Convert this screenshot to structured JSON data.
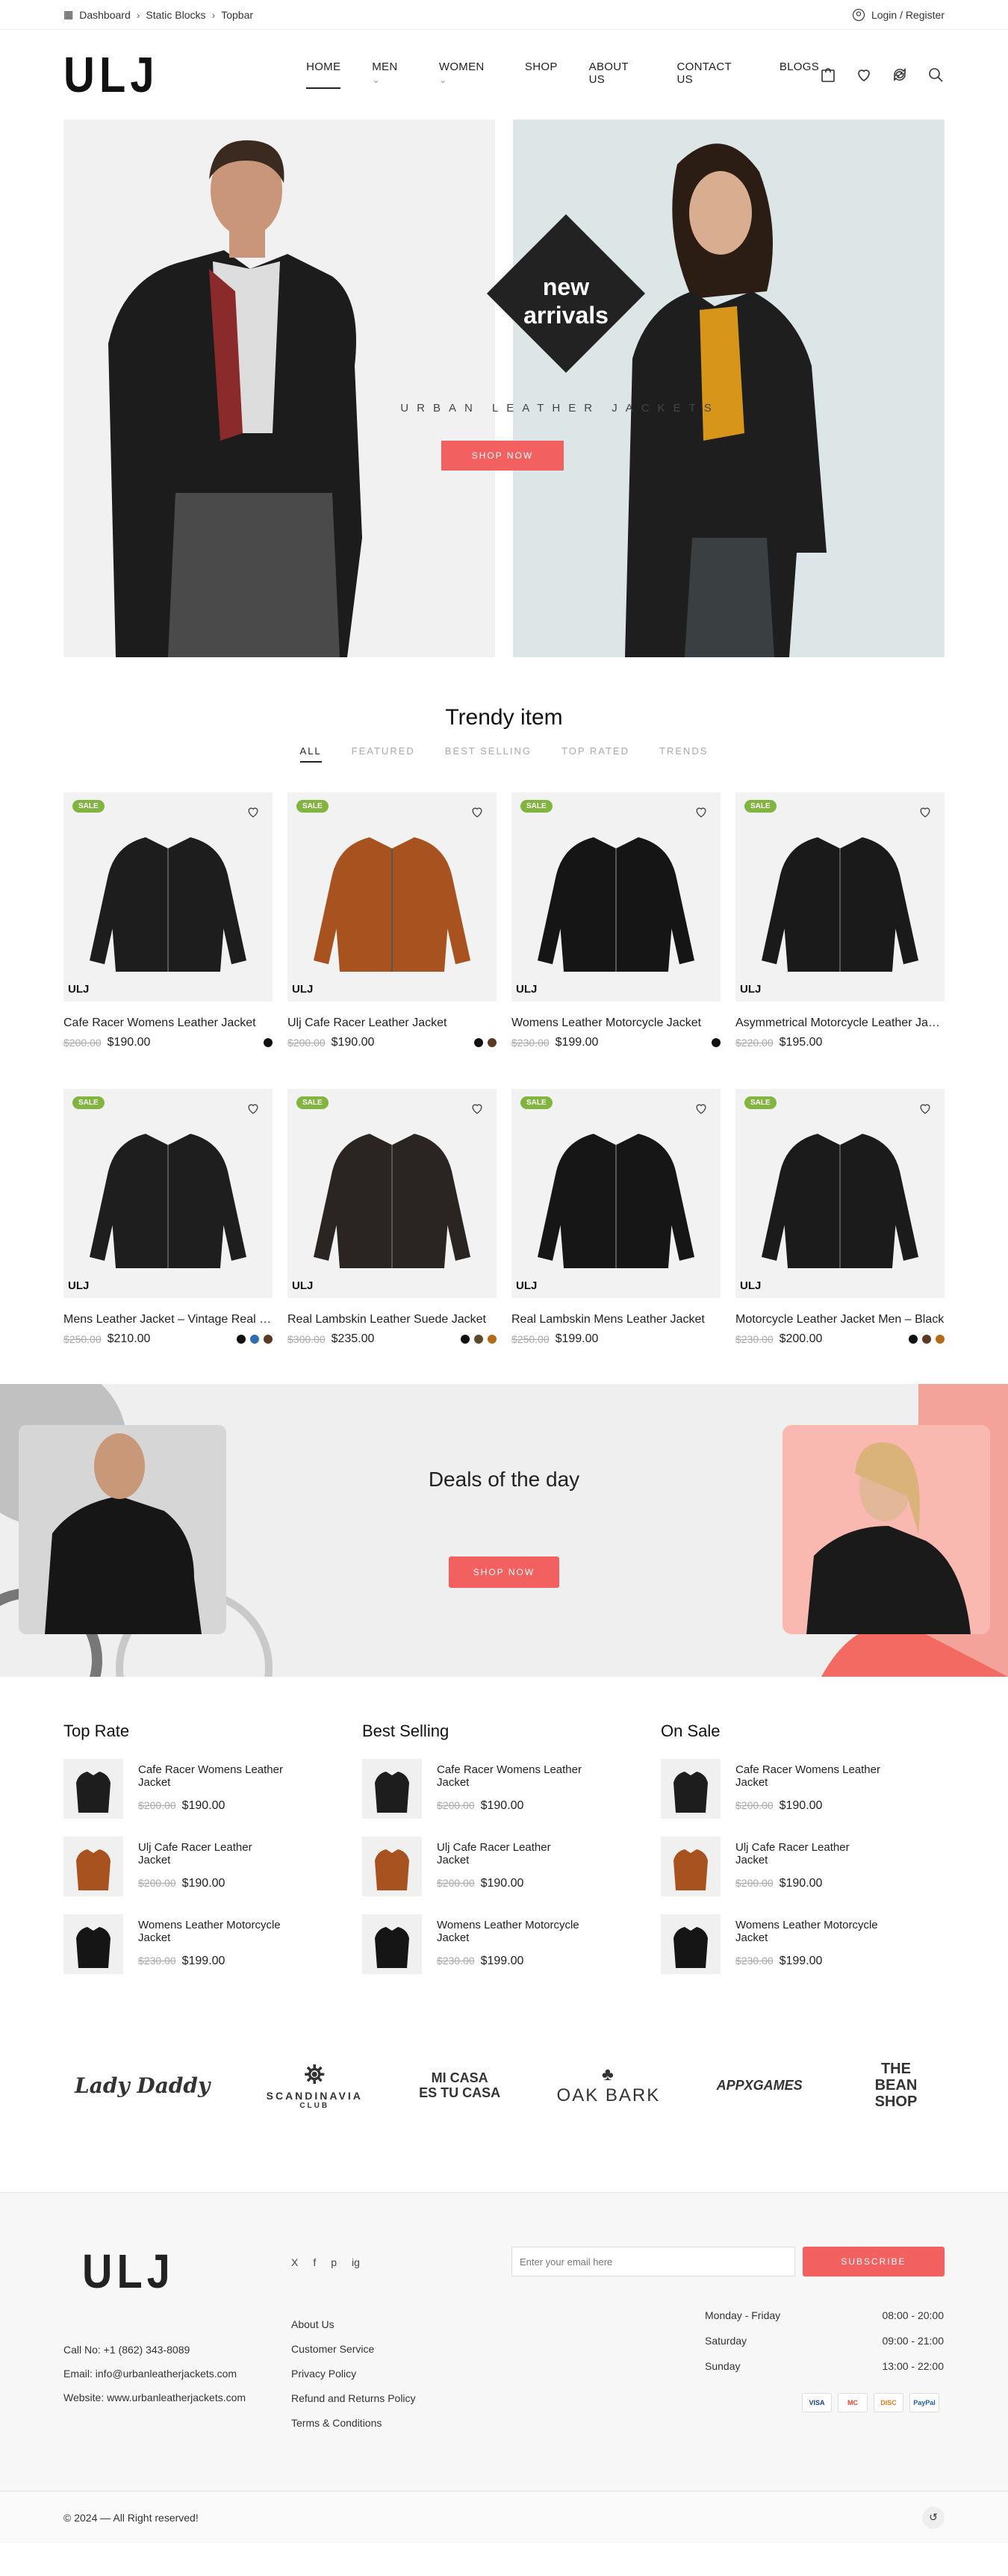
{
  "topbar": {
    "crumbs": [
      "Dashboard",
      "Static Blocks",
      "Topbar"
    ],
    "login": "Login / Register"
  },
  "header": {
    "logo": "ULJ",
    "nav": [
      "HOME",
      "MEN",
      "WOMEN",
      "SHOP",
      "ABOUT US",
      "CONTACT US",
      "BLOGS"
    ]
  },
  "hero": {
    "badge_line1": "new",
    "badge_line2": "arrivals",
    "subtitle": "URBAN LEATHER JACKETS",
    "button": "SHOP NOW"
  },
  "trendy": {
    "title": "Trendy item",
    "tabs": [
      "ALL",
      "FEATURED",
      "BEST SELLING",
      "TOP RATED",
      "TRENDS"
    ],
    "sale_label": "SALE",
    "products": [
      {
        "name": "Cafe Racer Womens Leather Jacket",
        "old": "$200.00",
        "price": "$190.00",
        "swatches": [
          "#111111"
        ]
      },
      {
        "name": "Ulj Cafe Racer Leather Jacket",
        "old": "$200.00",
        "price": "$190.00",
        "swatches": [
          "#111111",
          "#5a3a22"
        ]
      },
      {
        "name": "Womens Leather Motorcycle Jacket",
        "old": "$230.00",
        "price": "$199.00",
        "swatches": [
          "#111111"
        ]
      },
      {
        "name": "Asymmetrical Motorcycle Leather Jacket",
        "old": "$220.00",
        "price": "$195.00",
        "swatches": []
      },
      {
        "name": "Mens Leather Jacket – Vintage Real Leather",
        "old": "$250.00",
        "price": "$210.00",
        "swatches": [
          "#111111",
          "#2f6fb0",
          "#5a3a22"
        ]
      },
      {
        "name": "Real Lambskin Leather Suede Jacket",
        "old": "$300.00",
        "price": "$235.00",
        "swatches": [
          "#111111",
          "#5a4a2a",
          "#b56a1a"
        ]
      },
      {
        "name": "Real Lambskin Mens Leather Jacket",
        "old": "$250.00",
        "price": "$199.00",
        "swatches": []
      },
      {
        "name": "Motorcycle Leather Jacket Men – Black",
        "old": "$230.00",
        "price": "$200.00",
        "swatches": [
          "#111111",
          "#5a3a22",
          "#b56a1a"
        ]
      }
    ]
  },
  "deals": {
    "title": "Deals of the day",
    "button": "SHOP NOW"
  },
  "lists": [
    {
      "title": "Top Rate",
      "items": [
        {
          "name": "Cafe Racer Womens Leather Jacket",
          "old": "$200.00",
          "price": "$190.00"
        },
        {
          "name": "Ulj Cafe Racer Leather Jacket",
          "old": "$200.00",
          "price": "$190.00"
        },
        {
          "name": "Womens Leather Motorcycle Jacket",
          "old": "$230.00",
          "price": "$199.00"
        }
      ]
    },
    {
      "title": "Best Selling",
      "items": [
        {
          "name": "Cafe Racer Womens Leather Jacket",
          "old": "$200.00",
          "price": "$190.00"
        },
        {
          "name": "Ulj Cafe Racer Leather Jacket",
          "old": "$200.00",
          "price": "$190.00"
        },
        {
          "name": "Womens Leather Motorcycle Jacket",
          "old": "$230.00",
          "price": "$199.00"
        }
      ]
    },
    {
      "title": "On Sale",
      "items": [
        {
          "name": "Cafe Racer Womens Leather Jacket",
          "old": "$200.00",
          "price": "$190.00"
        },
        {
          "name": "Ulj Cafe Racer Leather Jacket",
          "old": "$200.00",
          "price": "$190.00"
        },
        {
          "name": "Womens Leather Motorcycle Jacket",
          "old": "$230.00",
          "price": "$199.00"
        }
      ]
    }
  ],
  "brands": [
    "Lady Daddy",
    "SCANDINAVIA",
    "CLUB",
    "MI CASA",
    "ES TU CASA",
    "OAK BARK",
    "APPXGAMES",
    "THE BEAN SHOP"
  ],
  "footer": {
    "logo": "ULJ",
    "phone": "Call No: +1 (862) 343-8089",
    "email": "Email: info@urbanleatherjackets.com",
    "website": "Website: www.urbanleatherjackets.com",
    "social": [
      "X",
      "f",
      "p",
      "ig"
    ],
    "links": [
      "About Us",
      "Customer Service",
      "Privacy Policy",
      "Refund and Returns Policy",
      "Terms & Conditions"
    ],
    "newsletter_placeholder": "Enter your email here",
    "subscribe": "SUBSCRIBE",
    "hours": [
      {
        "day": "Monday - Friday",
        "time": "08:00 - 20:00"
      },
      {
        "day": "Saturday",
        "time": "09:00 - 21:00"
      },
      {
        "day": "Sunday",
        "time": "13:00 - 22:00"
      }
    ],
    "payments": [
      "VISA",
      "MC",
      "DISC",
      "PayPal"
    ],
    "copyright": "© 2024 — All Right reserved!"
  }
}
